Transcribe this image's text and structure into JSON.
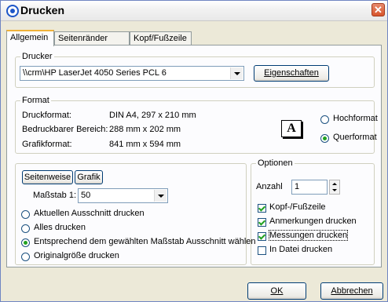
{
  "window": {
    "title": "Drucken"
  },
  "tabs": [
    {
      "label": "Allgemein",
      "active": true
    },
    {
      "label": "Seitenränder",
      "active": false
    },
    {
      "label": "Kopf/Fußzeile",
      "active": false
    }
  ],
  "printer": {
    "group_label": "Drucker",
    "selected": "\\\\crm\\HP LaserJet 4050 Series PCL 6",
    "properties_label": "Eigenschaften"
  },
  "format": {
    "group_label": "Format",
    "rows": [
      {
        "label": "Druckformat:",
        "value": "DIN A4, 297 x 210 mm"
      },
      {
        "label": "Bedruckbarer Bereich:",
        "value": "288 mm x 202 mm"
      },
      {
        "label": "Grafikformat:",
        "value": "841 mm x 594 mm"
      }
    ],
    "icon_letter": "A",
    "orientation": [
      {
        "label": "Hochformat",
        "selected": false
      },
      {
        "label": "Querformat",
        "selected": true
      }
    ]
  },
  "scale": {
    "tab_pagewise": "Seitenweise",
    "tab_graphic": "Grafik",
    "scale_label": "Maßstab 1:",
    "scale_value": "50",
    "options": [
      {
        "label": "Aktuellen Ausschnitt drucken",
        "selected": false
      },
      {
        "label": "Alles drucken",
        "selected": false
      },
      {
        "label": "Entsprechend dem gewählten Maßstab Ausschnitt wählen",
        "selected": true
      },
      {
        "label": "Originalgröße drucken",
        "selected": false
      }
    ]
  },
  "options": {
    "group_label": "Optionen",
    "count_label": "Anzahl",
    "count_value": "1",
    "checks": [
      {
        "label": "Kopf-/Fußzeile",
        "checked": true
      },
      {
        "label": "Anmerkungen drucken",
        "checked": true
      },
      {
        "label": "Messungen drucken",
        "checked": true
      },
      {
        "label": "In Datei drucken",
        "checked": false
      }
    ]
  },
  "footer": {
    "ok_label": "OK",
    "cancel_label": "Abbrechen"
  }
}
